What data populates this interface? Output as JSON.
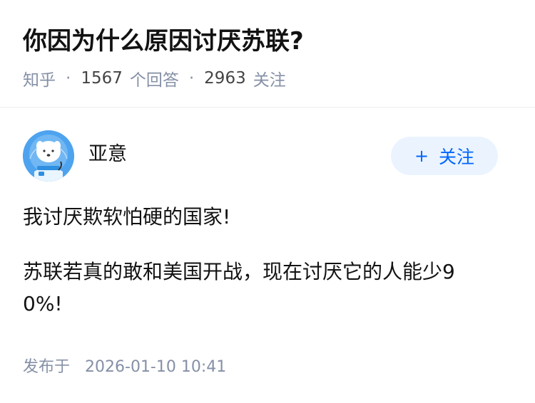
{
  "question": {
    "title": "你因为什么原因讨厌苏联?",
    "source": "知乎",
    "answer_count": "1567",
    "answer_label": "个回答",
    "follower_count": "2963",
    "follower_label": "关注"
  },
  "answer": {
    "author_name": "亚意",
    "avatar_icon": "astronaut-dog-avatar",
    "follow_icon": "plus-icon",
    "follow_symbol": "+",
    "follow_label": "关注",
    "paragraphs": [
      "我讨厌欺软怕硬的国家!",
      "苏联若真的敢和美国开战，现在讨厌它的人能少90%!"
    ],
    "published_label": "发布于",
    "published_time": "2026-01-10 10:41"
  },
  "colors": {
    "accent": "#0066ff",
    "follow_bg": "#ebf4fe",
    "meta_gray": "#8590a6",
    "text": "#121212",
    "divider": "#ededed"
  }
}
